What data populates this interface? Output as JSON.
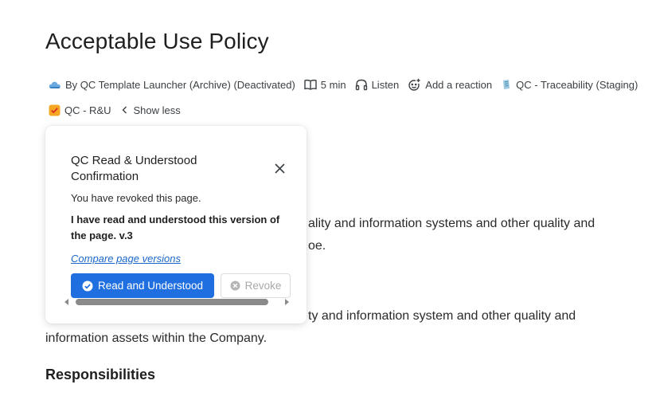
{
  "page": {
    "title": "Acceptable Use Policy"
  },
  "meta": {
    "author": "By QC Template Launcher (Archive) (Deactivated)",
    "read_time": "5 min",
    "listen": "Listen",
    "reaction": "Add a reaction",
    "label_traceability": "QC - Traceability (Staging)",
    "label_ru": "QC - R&U",
    "show_less": "Show less"
  },
  "content": {
    "line1": "ality and information systems and other quality and",
    "line2": "oe.",
    "line3": "ty and information system and other quality and",
    "line4": "information assets within the Company.",
    "heading": "Responsibilities"
  },
  "popover": {
    "title": "QC Read & Understood Confirmation",
    "revoked": "You have revoked this page.",
    "confirm": "I have read and understood this version of the page. v.3",
    "compare_link": "Compare page versions",
    "primary_label": "Read and Understood",
    "secondary_label": "Revoke"
  },
  "colors": {
    "primary": "#1f6fe0",
    "link": "#1a67c9",
    "disabled": "#a8a8a8"
  },
  "icons": {
    "author": "cloud-avatar-icon",
    "read_time": "book-icon",
    "listen": "headphones-icon",
    "reaction": "smiley-add-icon",
    "traceability": "traceability-app-icon",
    "ru": "checkbox-badge-icon",
    "show_less": "chevron-left-icon",
    "close": "close-icon",
    "primary": "check-circle-icon",
    "secondary": "x-circle-icon"
  }
}
